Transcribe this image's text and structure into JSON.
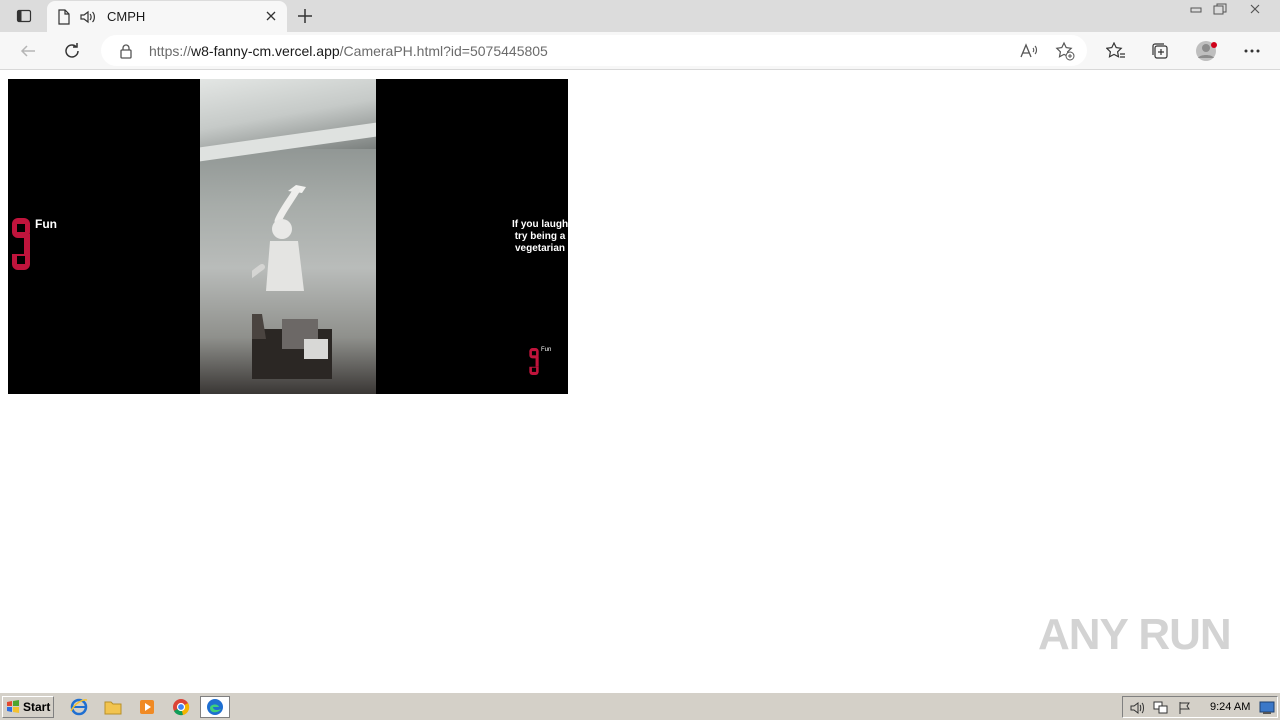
{
  "browser": {
    "tab_title": "CMPH",
    "url_prefix": "https://",
    "url_host": "w8-fanny-cm.vercel.app",
    "url_path": "/CameraPH.html?id=5075445805"
  },
  "video": {
    "brand_label": "Fun",
    "brand_label_small": "Fun",
    "caption": "If you laugh try being a vegetarian"
  },
  "watermark": {
    "text": "ANY RUN"
  },
  "taskbar": {
    "start_label": "Start",
    "clock": "9:24 AM"
  },
  "colors": {
    "brand_red": "#c0143c",
    "edge_blue": "#1f6fd1",
    "taskbar": "#d4d0c8"
  }
}
